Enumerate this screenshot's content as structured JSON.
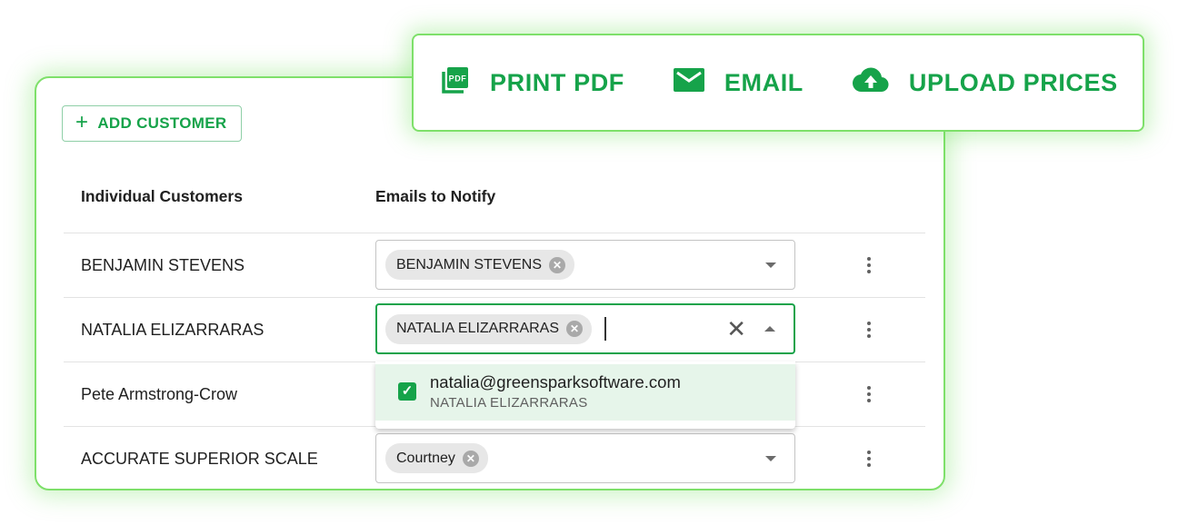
{
  "toolbar": {
    "print_label": "PRINT PDF",
    "print_icon": "pdf-icon",
    "print_icon_text": "PDF",
    "email_label": "EMAIL",
    "email_icon": "mail-icon",
    "upload_label": "UPLOAD PRICES",
    "upload_icon": "cloud-upload-icon"
  },
  "add_customer_label": "ADD CUSTOMER",
  "table": {
    "headers": [
      "Individual Customers",
      "Emails to Notify"
    ],
    "rows": [
      {
        "customer": "BENJAMIN STEVENS",
        "chips": [
          "BENJAMIN STEVENS"
        ]
      },
      {
        "customer": "NATALIA ELIZARRARAS",
        "chips": [
          "NATALIA ELIZARRARAS"
        ]
      },
      {
        "customer": "Pete Armstrong-Crow",
        "chips": []
      },
      {
        "customer": "ACCURATE SUPERIOR SCALE",
        "chips": [
          "Courtney"
        ]
      }
    ]
  },
  "dropdown": {
    "options": [
      {
        "email": "natalia@greensparksoftware.com",
        "name": "NATALIA ELIZARRARAS",
        "checked": true
      }
    ]
  },
  "colors": {
    "accent": "#16a34a",
    "glow": "#7ee06a",
    "selected_bg": "#e6f5ea"
  }
}
